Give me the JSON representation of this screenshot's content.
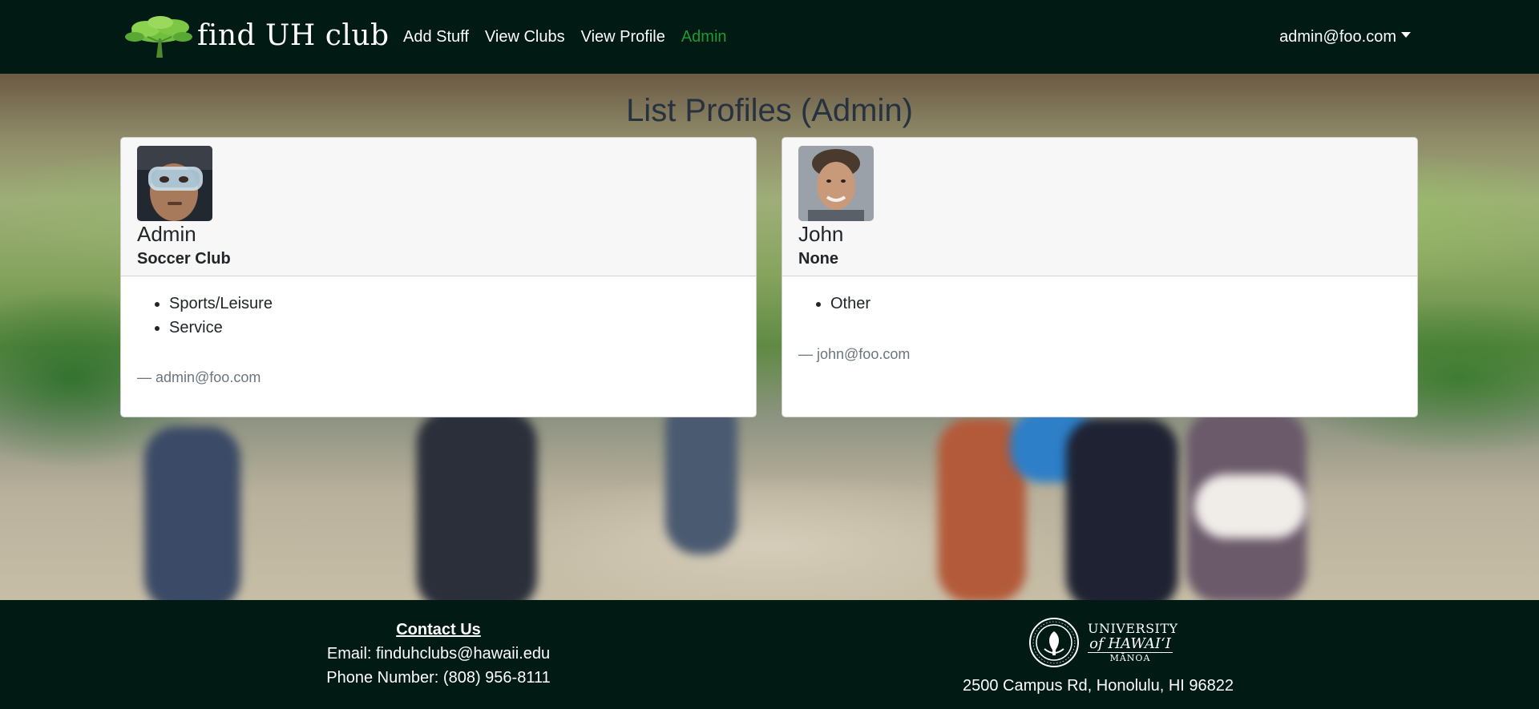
{
  "navbar": {
    "brand_text": "find UH club",
    "links": [
      {
        "label": "Add Stuff"
      },
      {
        "label": "View Clubs"
      },
      {
        "label": "View Profile"
      },
      {
        "label": "Admin",
        "active": true
      }
    ],
    "user_email": "admin@foo.com",
    "active_color": "#1e9a33",
    "background_color": "#011a13"
  },
  "page": {
    "title": "List Profiles (Admin)"
  },
  "profiles": [
    {
      "name": "Admin",
      "club": "Soccer Club",
      "interests": [
        "Sports/Leisure",
        "Service"
      ],
      "email_line": "— admin@foo.com",
      "avatar_icon": "profile-photo-diver-mask"
    },
    {
      "name": "John",
      "club": "None",
      "interests": [
        "Other"
      ],
      "email_line": "— john@foo.com",
      "avatar_icon": "profile-photo-smiling-man"
    }
  ],
  "footer": {
    "contact_heading": "Contact Us",
    "email_line": "Email: finduhclubs@hawaii.edu",
    "phone_line": "Phone Number: (808) 956-8111",
    "logo_text": {
      "line1": "UNIVERSITY",
      "line2": "of HAWAI‘I",
      "line3": "MĀNOA"
    },
    "address": "2500 Campus Rd, Honolulu, HI 96822"
  }
}
